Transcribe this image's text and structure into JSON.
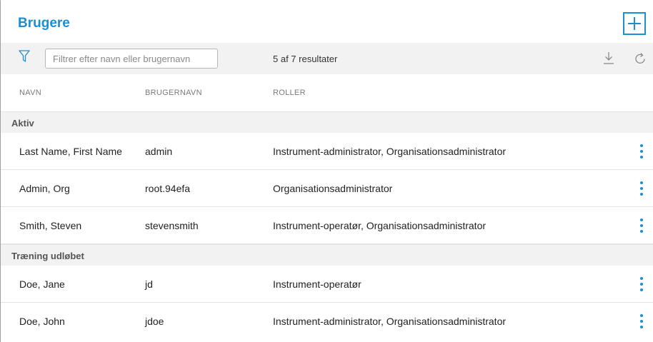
{
  "header": {
    "title": "Brugere",
    "add_icon": "plus-icon"
  },
  "toolbar": {
    "filter_icon": "funnel-icon",
    "search_placeholder": "Filtrer efter navn eller brugernavn",
    "search_value": "",
    "results_text": "5 af 7 resultater",
    "download_icon": "download-icon",
    "refresh_icon": "refresh-icon"
  },
  "columns": {
    "name": "NAVN",
    "username": "BRUGERNAVN",
    "roles": "ROLLER"
  },
  "groups": [
    {
      "label": "Aktiv",
      "rows": [
        {
          "name": "Last Name, First Name",
          "username": "admin",
          "roles": "Instrument-administrator, Organisationsadministrator"
        },
        {
          "name": "Admin, Org",
          "username": "root.94efa",
          "roles": "Organisationsadministrator"
        },
        {
          "name": "Smith, Steven",
          "username": "stevensmith",
          "roles": "Instrument-operatør, Organisationsadministrator"
        }
      ]
    },
    {
      "label": "Træning udløbet",
      "rows": [
        {
          "name": "Doe, Jane",
          "username": "jd",
          "roles": "Instrument-operatør"
        },
        {
          "name": "Doe, John",
          "username": "jdoe",
          "roles": "Instrument-administrator, Organisationsadministrator"
        }
      ]
    }
  ],
  "colors": {
    "accent": "#1a8fd1",
    "toolbar_bg": "#f2f2f2",
    "group_bg": "#f2f2f2"
  }
}
